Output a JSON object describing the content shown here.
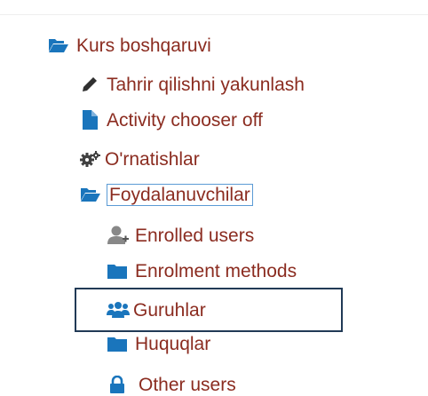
{
  "colors": {
    "link_text": "#8b2c20",
    "icon_blue": "#1a75bc",
    "icon_dark": "#303030",
    "icon_grey": "#888888",
    "highlight_border": "#213a56",
    "focus_outline": "#5b9bd5"
  },
  "tree": {
    "root": {
      "label": "Kurs boshqaruvi",
      "icon": "folder-open-icon"
    },
    "items": [
      {
        "label": "Tahrir qilishni yakunlash",
        "icon": "pencil-icon"
      },
      {
        "label": "Activity chooser off",
        "icon": "file-icon"
      },
      {
        "label": "O'rnatishlar",
        "icon": "cogs-icon"
      },
      {
        "label": "Foydalanuvchilar",
        "icon": "folder-open-icon"
      }
    ],
    "users_children": [
      {
        "label": "Enrolled users",
        "icon": "user-plus-icon"
      },
      {
        "label": "Enrolment methods",
        "icon": "folder-icon"
      },
      {
        "label": "Guruhlar",
        "icon": "users-icon"
      },
      {
        "label": "Huquqlar",
        "icon": "folder-icon"
      },
      {
        "label": "Other users",
        "icon": "lock-icon"
      }
    ]
  }
}
